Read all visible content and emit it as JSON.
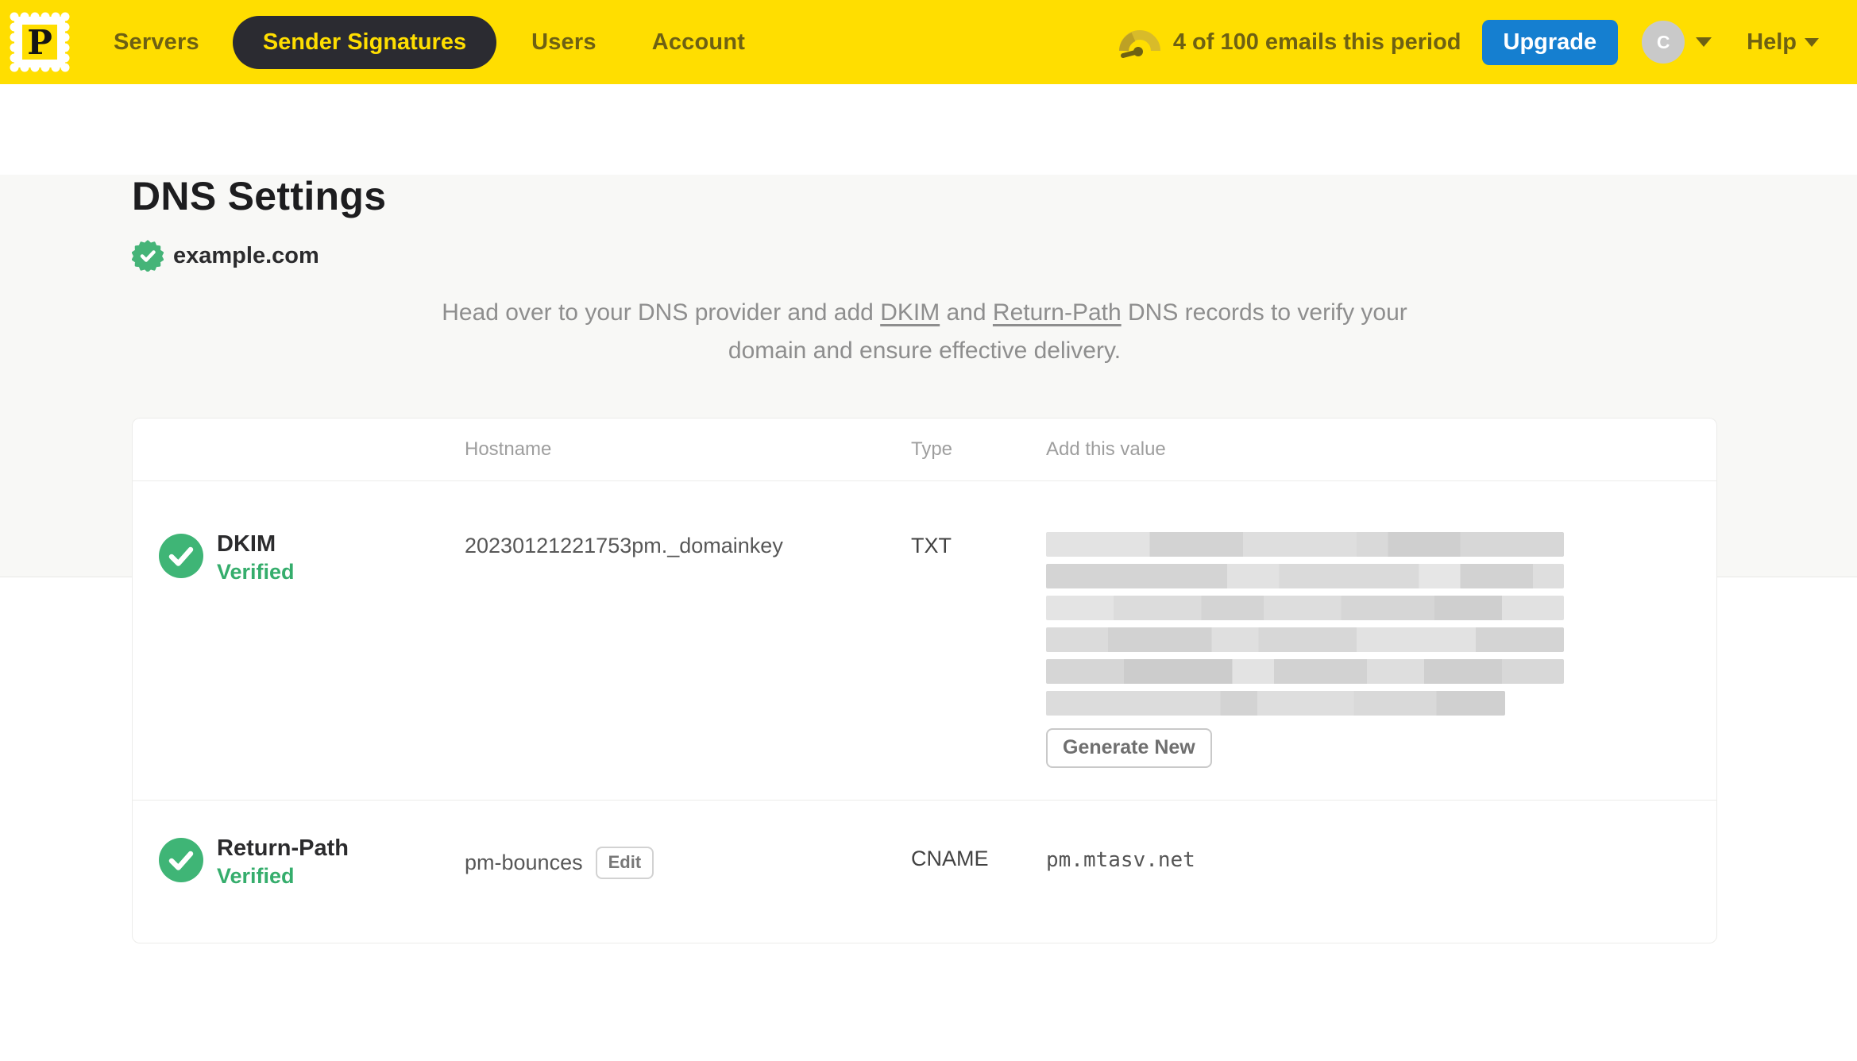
{
  "nav": {
    "logo_letter": "P",
    "items": [
      {
        "label": "Servers",
        "active": false
      },
      {
        "label": "Sender Signatures",
        "active": true
      },
      {
        "label": "Users",
        "active": false
      },
      {
        "label": "Account",
        "active": false
      }
    ],
    "usage_text": "4 of 100 emails this period",
    "upgrade_label": "Upgrade",
    "avatar_initial": "C",
    "help_label": "Help"
  },
  "page": {
    "title": "DNS Settings",
    "domain": "example.com",
    "desc": {
      "p1": "Head over to your DNS provider and add ",
      "link_dkim": "DKIM",
      "p2": " and ",
      "link_return": "Return-Path",
      "p3": " DNS records to verify your domain and ensure effective delivery."
    }
  },
  "table": {
    "headers": {
      "hostname": "Hostname",
      "type": "Type",
      "value": "Add this value"
    },
    "rows": [
      {
        "name": "DKIM",
        "status": "Verified",
        "hostname": "20230121221753pm._domainkey",
        "type": "TXT",
        "value_redacted": true,
        "action_label": "Generate New"
      },
      {
        "name": "Return-Path",
        "status": "Verified",
        "hostname": "pm-bounces",
        "hostname_action": "Edit",
        "type": "CNAME",
        "value": "pm.mtasv.net"
      }
    ]
  },
  "colors": {
    "brand_yellow": "#FFDE00",
    "nav_text": "#6E6113",
    "upgrade_blue": "#157FD0",
    "verified_green": "#35AD6C",
    "check_green": "#3FB576"
  }
}
